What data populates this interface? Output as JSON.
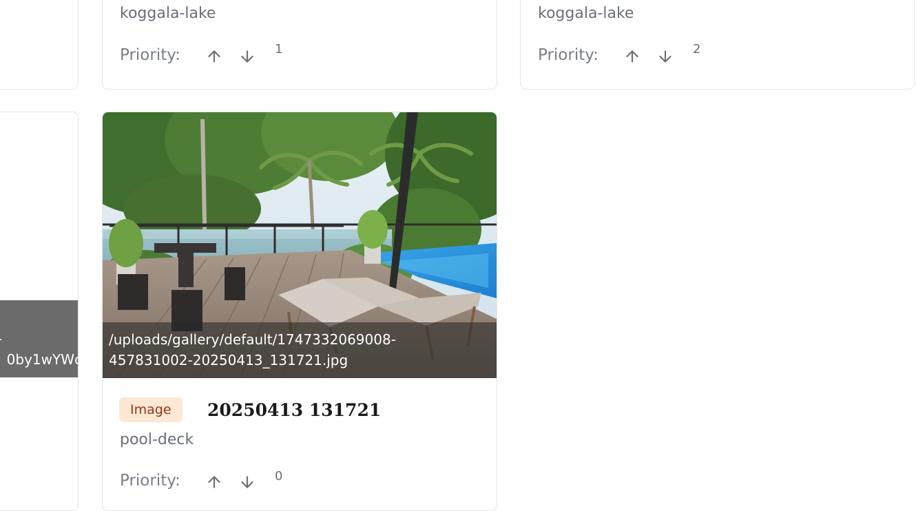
{
  "cards": [
    {
      "slug": "koggala-lake",
      "priority_label": "Priority:",
      "priority_value": "1"
    },
    {
      "slug": "koggala-lake",
      "priority_label": "Priority:",
      "priority_value": "2"
    },
    {
      "caption_line1": "/uploads/gallery/default/1747332069008-",
      "caption_line2": "457831002-20250413_131721.jpg",
      "badge": "Image",
      "title": "20250413 131721",
      "slug": "pool-deck",
      "priority_label": "Priority:",
      "priority_value": "0"
    },
    {
      "caption_line1": "-",
      "caption_line2": "0by1wYWc"
    }
  ],
  "icons": {
    "up": "arrow-up-icon",
    "down": "arrow-down-icon"
  },
  "colors": {
    "badge_bg": "#fde8d4",
    "badge_text": "#9a3412",
    "border": "#e3e5ea"
  }
}
